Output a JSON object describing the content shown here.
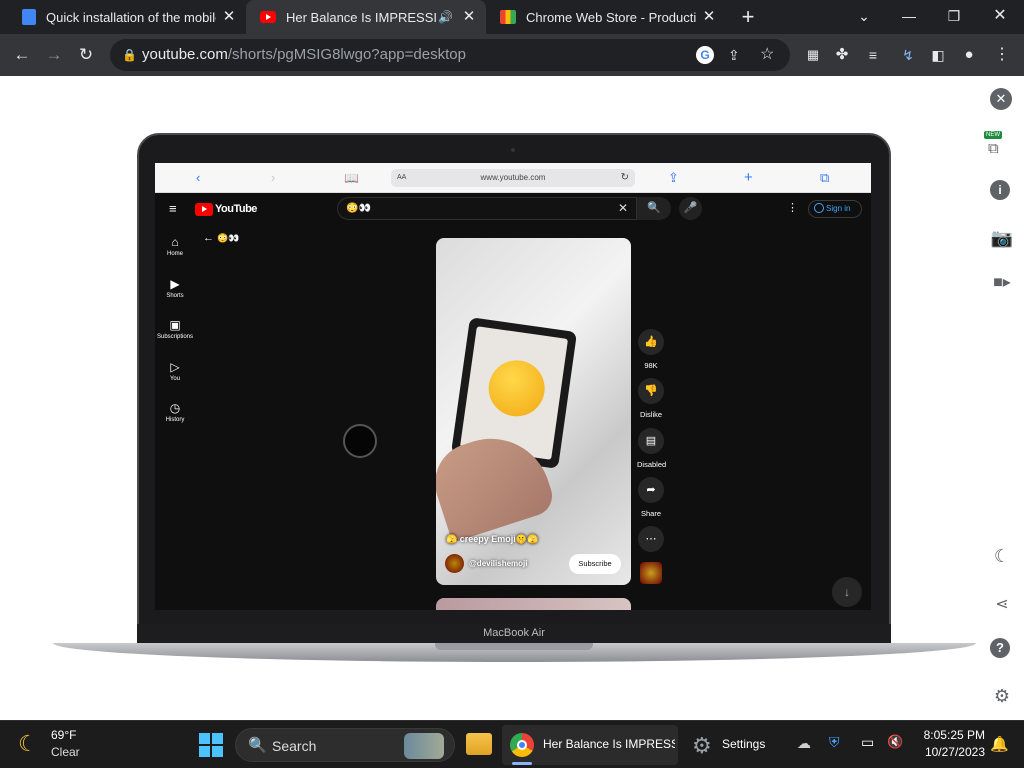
{
  "browser": {
    "tabs": [
      {
        "title": "Quick installation of the mobile a",
        "icon": "document-favicon-icon",
        "active": false
      },
      {
        "title": "Her Balance Is IMPRESSIVE!",
        "icon": "youtube-favicon-icon",
        "active": true
      },
      {
        "title": "Chrome Web Store - Productivity",
        "icon": "chrome-web-store-favicon-icon",
        "active": false
      }
    ],
    "url_host": "youtube.com",
    "url_rest": "/shorts/pgMSIG8lwgo?app=desktop"
  },
  "extension_rail": {
    "new_badge": "NEW"
  },
  "laptop": {
    "brand_label": "MacBook Air",
    "safari": {
      "url": "www.youtube.com",
      "aa_label": "AA"
    },
    "youtube": {
      "logo_text": "YouTube",
      "search_value": "😳👀",
      "signin_label": "Sign in",
      "back_query": "😳👀",
      "nav": [
        {
          "label": "Home",
          "icon": "home-icon"
        },
        {
          "label": "Shorts",
          "icon": "shorts-icon"
        },
        {
          "label": "Subscriptions",
          "icon": "subscriptions-icon"
        },
        {
          "label": "You",
          "icon": "you-icon"
        },
        {
          "label": "History",
          "icon": "history-icon"
        }
      ],
      "short": {
        "caption": "🫣 creepy Emoji🤫🫣",
        "channel": "@devilishemoji",
        "subscribe_label": "Subscribe"
      },
      "actions": [
        {
          "label": "98K",
          "icon": "like-icon"
        },
        {
          "label": "Dislike",
          "icon": "dislike-icon"
        },
        {
          "label": "Disabled",
          "icon": "comments-icon"
        },
        {
          "label": "Share",
          "icon": "share-icon"
        }
      ]
    }
  },
  "taskbar": {
    "weather_temp": "69°F",
    "weather_desc": "Clear",
    "search_placeholder": "Search",
    "chrome_label": "Her Balance Is IMPRESSI",
    "settings_label": "Settings",
    "time": "8:05:25 PM",
    "date": "10/27/2023"
  }
}
